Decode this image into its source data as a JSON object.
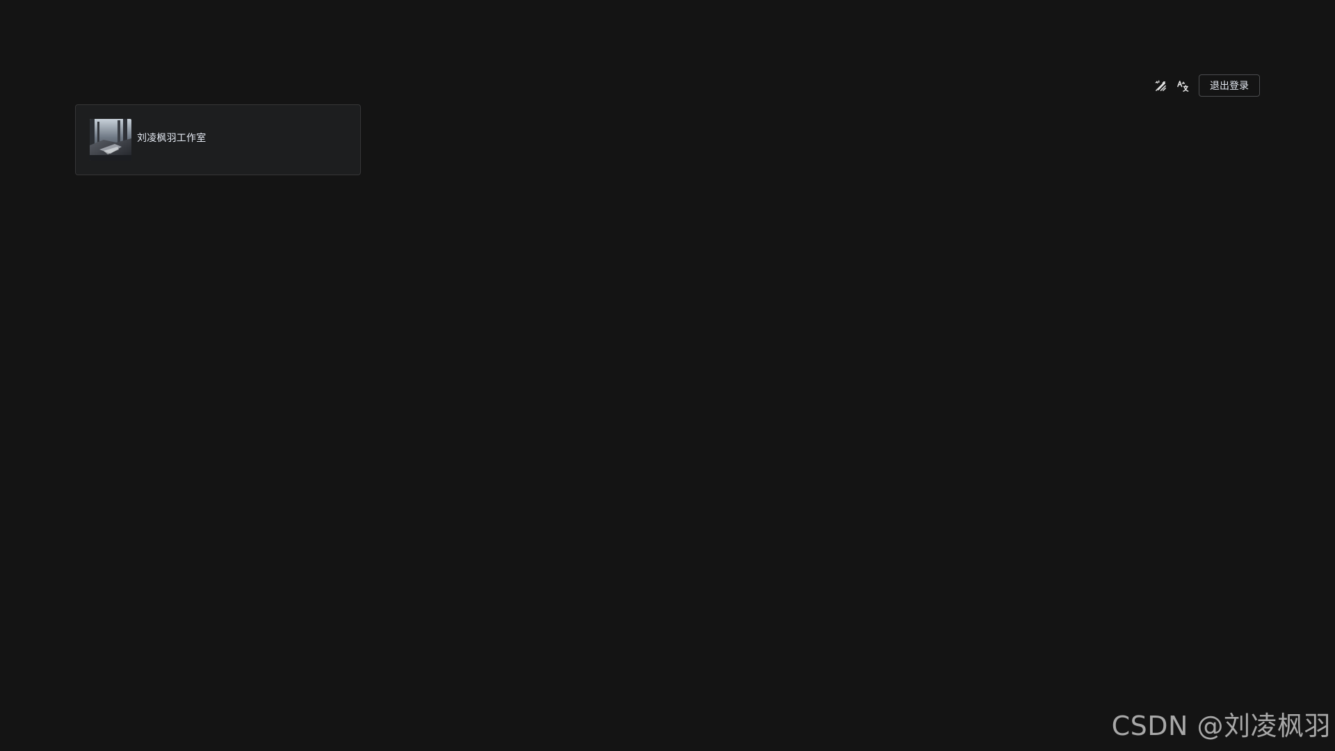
{
  "header": {
    "icons": [
      {
        "name": "theme-toggle-icon"
      },
      {
        "name": "language-translate-icon"
      }
    ],
    "logout_label": "退出登录"
  },
  "apps": [
    {
      "name": "刘凌枫羽工作室",
      "thumbnail": "studio-photo"
    }
  ],
  "watermark": "CSDN @刘凌枫羽",
  "colors": {
    "background": "#141414",
    "card_background": "#1d1e1f",
    "card_border": "#363637",
    "text": "#e5eaf3"
  }
}
